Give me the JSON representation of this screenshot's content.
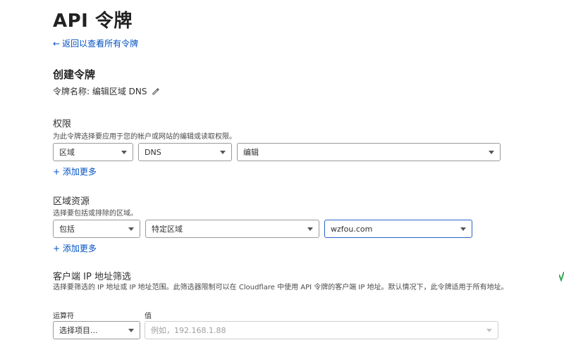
{
  "header": {
    "title": "API 令牌",
    "back_link": "返回以查看所有令牌"
  },
  "form": {
    "section_title": "创建令牌",
    "token_name": "令牌名称: 编辑区域 DNS"
  },
  "permissions": {
    "label": "权限",
    "description": "为此令牌选择要应用于您的帐户或网站的编辑或读取权限。",
    "selects": [
      "区域",
      "DNS",
      "编辑"
    ],
    "add_more": "+ 添加更多"
  },
  "zone_resources": {
    "label": "区域资源",
    "description": "选择要包括或排除的区域。",
    "selects": [
      "包括",
      "特定区域",
      "wzfou.com"
    ],
    "add_more": "+ 添加更多"
  },
  "ip_filter": {
    "label": "客户端 IP 地址筛选",
    "description": "选择要筛选的 IP 地址或 IP 地址范围。此筛选器限制可以在 Cloudflare 中使用 API 令牌的客户端 IP 地址。默认情况下，此令牌适用于所有地址。",
    "operator_label": "运算符",
    "value_label": "值",
    "operator_select": "选择项目...",
    "value_placeholder": "例如，192.168.1.88"
  },
  "colors": {
    "link": "#0051c3",
    "focus_border": "#2b62c4",
    "edge_mark": "#34a853"
  }
}
